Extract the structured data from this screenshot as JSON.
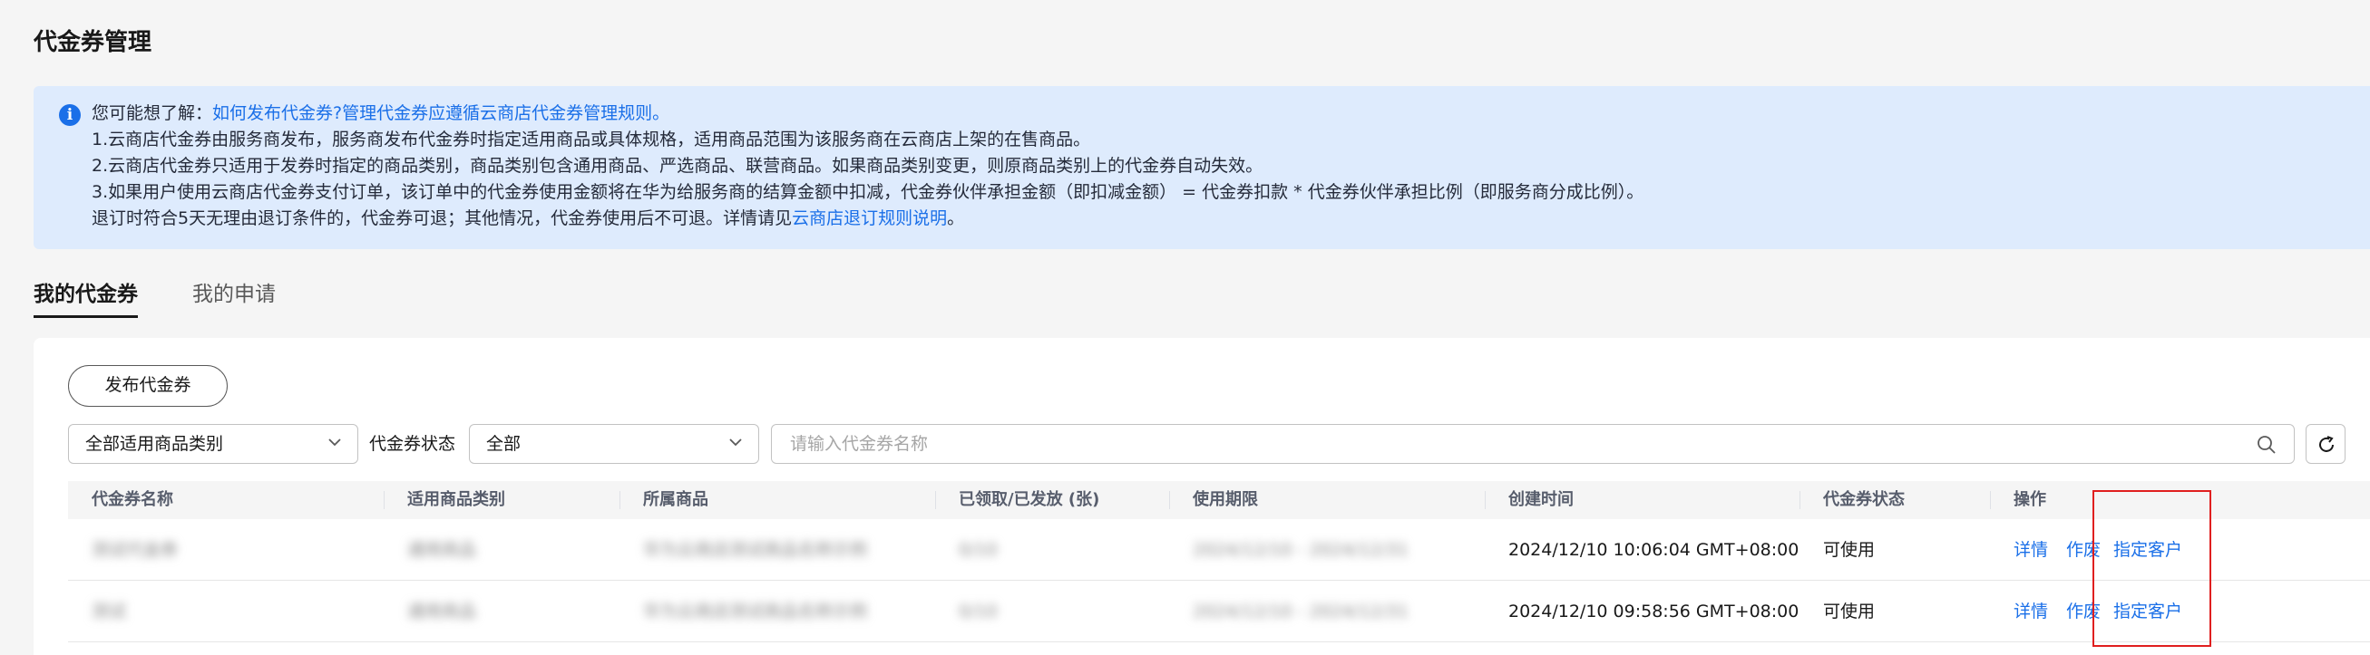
{
  "page": {
    "title": "代金券管理"
  },
  "notice": {
    "prefix": "您可能想了解：",
    "link1": "如何发布代金券?",
    "link2": "管理代金券应遵循云商店代金券管理规则。",
    "line1": "1.云商店代金券由服务商发布，服务商发布代金券时指定适用商品或具体规格，适用商品范围为该服务商在云商店上架的在售商品。",
    "line2": "2.云商店代金券只适用于发券时指定的商品类别，商品类别包含通用商品、严选商品、联营商品。如果商品类别变更，则原商品类别上的代金券自动失效。",
    "line3": "3.如果用户使用云商店代金券支付订单，该订单中的代金券使用金额将在华为给服务商的结算金额中扣减，代金券伙伴承担金额（即扣减金额） = 代金券扣款 * 代金券伙伴承担比例（即服务商分成比例）。",
    "line4_prefix": "退订时符合5天无理由退订条件的，代金券可退；其他情况，代金券使用后不可退。详情请见",
    "line4_link": "云商店退订规则说明",
    "line4_suffix": "。"
  },
  "tabs": [
    {
      "label": "我的代金券",
      "active": true
    },
    {
      "label": "我的申请",
      "active": false
    }
  ],
  "toolbar": {
    "publish_label": "发布代金券",
    "category_select": "全部适用商品类别",
    "status_label": "代金券状态",
    "status_select": "全部",
    "search_placeholder": "请输入代金券名称"
  },
  "table": {
    "columns": [
      "代金券名称",
      "适用商品类别",
      "所属商品",
      "已领取/已发放 (张)",
      "使用期限",
      "创建时间",
      "代金券状态",
      "操作"
    ],
    "rows": [
      {
        "name": "测试代金券",
        "category": "通用商品",
        "product": "华为云商店测试商品名称示例",
        "issued": "0/10",
        "period": "2024/12/10 - 2024/12/31",
        "created": "2024/12/10 10:06:04 GMT+08:00",
        "status": "可使用",
        "actions": [
          "详情",
          "作废",
          "指定客户"
        ]
      },
      {
        "name": "测试",
        "category": "通用商品",
        "product": "华为云商店测试商品名称示例",
        "issued": "0/10",
        "period": "2024/12/10 - 2024/12/31",
        "created": "2024/12/10 09:58:56 GMT+08:00",
        "status": "可使用",
        "actions": [
          "详情",
          "作废",
          "指定客户"
        ]
      }
    ]
  },
  "colors": {
    "link": "#1a6fe8",
    "notice_bg": "#deebfd",
    "highlight": "#e01f1f"
  }
}
